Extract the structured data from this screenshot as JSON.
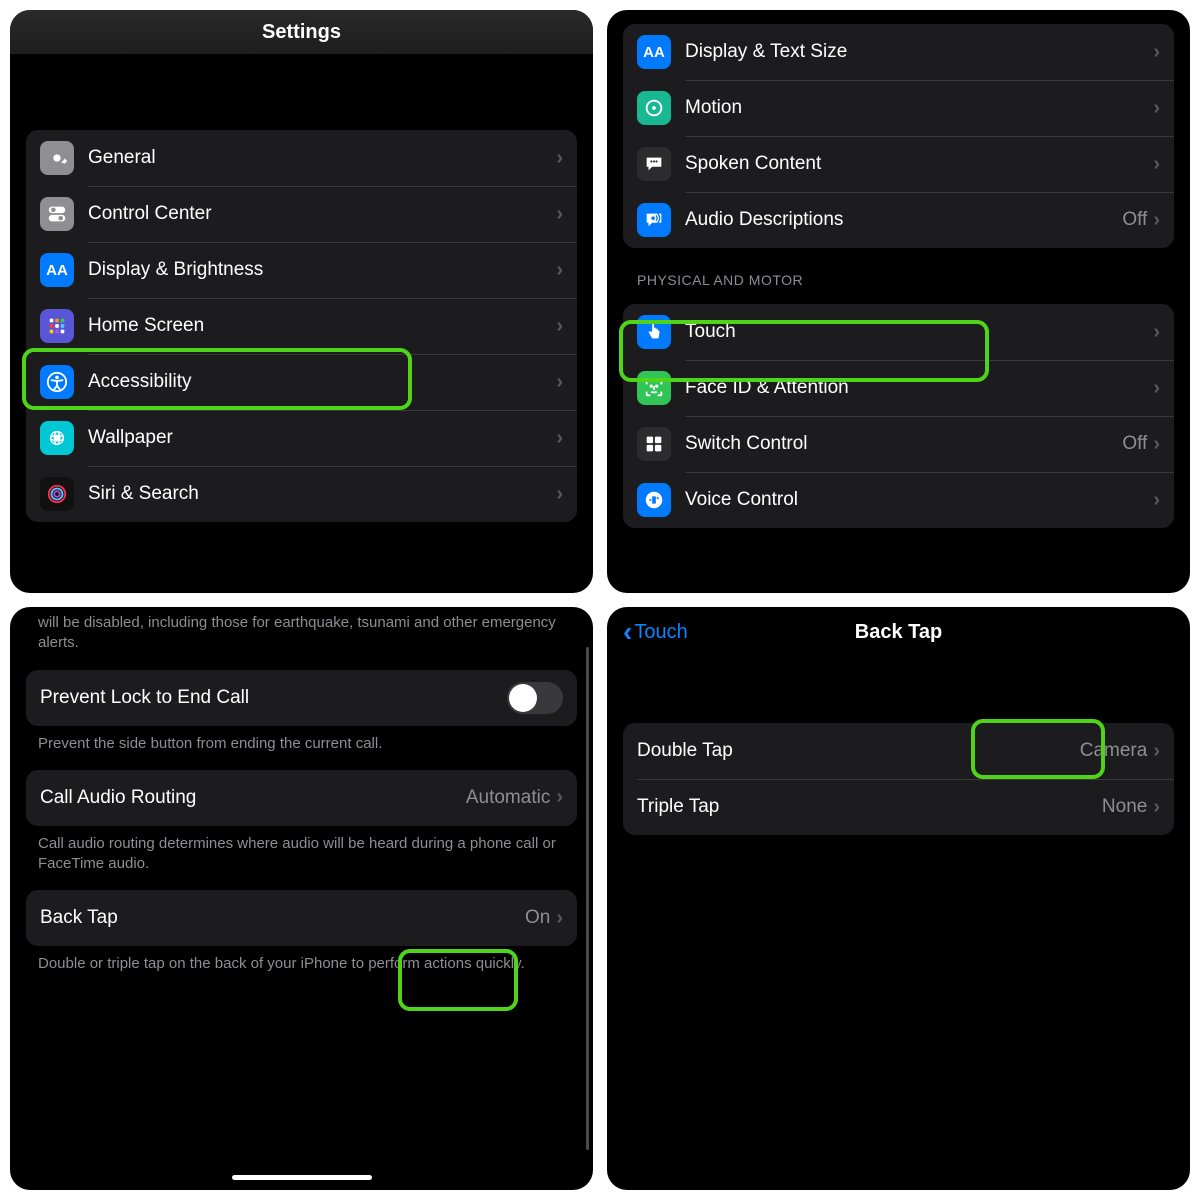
{
  "panel1": {
    "title": "Settings",
    "items": [
      {
        "label": "General"
      },
      {
        "label": "Control Center"
      },
      {
        "label": "Display & Brightness"
      },
      {
        "label": "Home Screen"
      },
      {
        "label": "Accessibility"
      },
      {
        "label": "Wallpaper"
      },
      {
        "label": "Siri & Search"
      }
    ]
  },
  "panel2": {
    "vision_items": [
      {
        "label": "Display & Text Size"
      },
      {
        "label": "Motion"
      },
      {
        "label": "Spoken Content"
      },
      {
        "label": "Audio Descriptions",
        "value": "Off"
      }
    ],
    "section_header": "PHYSICAL AND MOTOR",
    "motor_items": [
      {
        "label": "Touch"
      },
      {
        "label": "Face ID & Attention"
      },
      {
        "label": "Switch Control",
        "value": "Off"
      },
      {
        "label": "Voice Control"
      }
    ]
  },
  "panel3": {
    "disabled_text": "will be disabled, including those for earthquake, tsunami and other emergency alerts.",
    "prevent_lock": {
      "label": "Prevent Lock to End Call"
    },
    "prevent_lock_footer": "Prevent the side button from ending the current call.",
    "call_audio": {
      "label": "Call Audio Routing",
      "value": "Automatic"
    },
    "call_audio_footer": "Call audio routing determines where audio will be heard during a phone call or FaceTime audio.",
    "back_tap": {
      "label": "Back Tap",
      "value": "On"
    },
    "back_tap_footer": "Double or triple tap on the back of your iPhone to perform actions quickly."
  },
  "panel4": {
    "back_label": "Touch",
    "title": "Back Tap",
    "items": [
      {
        "label": "Double Tap",
        "value": "Camera"
      },
      {
        "label": "Triple Tap",
        "value": "None"
      }
    ]
  }
}
